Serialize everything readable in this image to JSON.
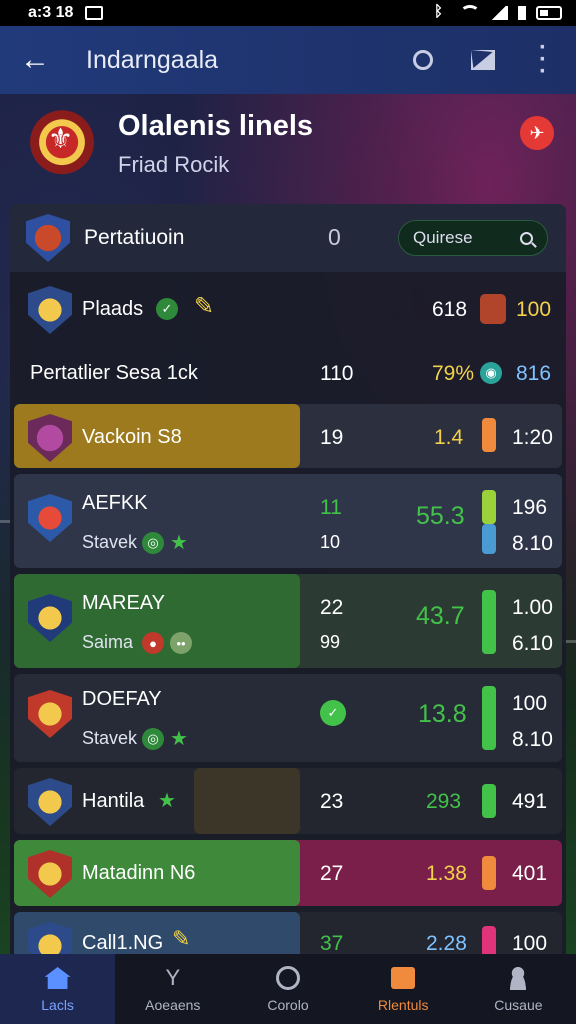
{
  "status_bar": {
    "time": "a:3 18"
  },
  "app_bar": {
    "title": "Indarngaala"
  },
  "team": {
    "name": "Olalenis linels",
    "subtitle": "Friad Rocik"
  },
  "panel": {
    "title": "Pertatiuoin",
    "value": "0",
    "search_placeholder": "Quirese"
  },
  "rows": [
    {
      "name": "Plaads",
      "val_a": "618",
      "val_b": "100"
    },
    {
      "name": "Pertatlier Sesa 1ck",
      "val_a": "110",
      "val_b": "79%",
      "val_c": "816"
    },
    {
      "name": "Vackoin S8",
      "val_a": "19",
      "val_b": "1.4",
      "val_c": "1:20"
    },
    {
      "name": "AEFKK",
      "sub": "Stavek",
      "val_a": "11",
      "val_a2": "10",
      "val_b": "55.3",
      "val_c": "196",
      "val_c2": "8.10"
    },
    {
      "name": "MAREAY",
      "sub": "Saima",
      "val_a": "22",
      "val_a2": "99",
      "val_b": "43.7",
      "val_c": "1.00",
      "val_c2": "6.10"
    },
    {
      "name": "DOEFAY",
      "sub": "Stavek",
      "val_b": "13.8",
      "val_c": "100",
      "val_c2": "8.10"
    },
    {
      "name": "Hantila",
      "val_a": "23",
      "val_b": "293",
      "val_c": "491"
    },
    {
      "name": "Matadinn N6",
      "val_a": "27",
      "val_b": "1.38",
      "val_c": "401"
    },
    {
      "name": "Call1.NG",
      "val_a": "37",
      "val_b": "2.28",
      "val_c": "100"
    }
  ],
  "nav": [
    {
      "label": "Lacls"
    },
    {
      "label": "Aoeaens"
    },
    {
      "label": "Corolo"
    },
    {
      "label": "Rlentuls"
    },
    {
      "label": "Cusaue"
    }
  ],
  "colors": {
    "accent_green": "#43c24a",
    "accent_orange": "#f08a3c",
    "accent_yellow": "#f2d24b",
    "app_bar": "#213a7a"
  }
}
